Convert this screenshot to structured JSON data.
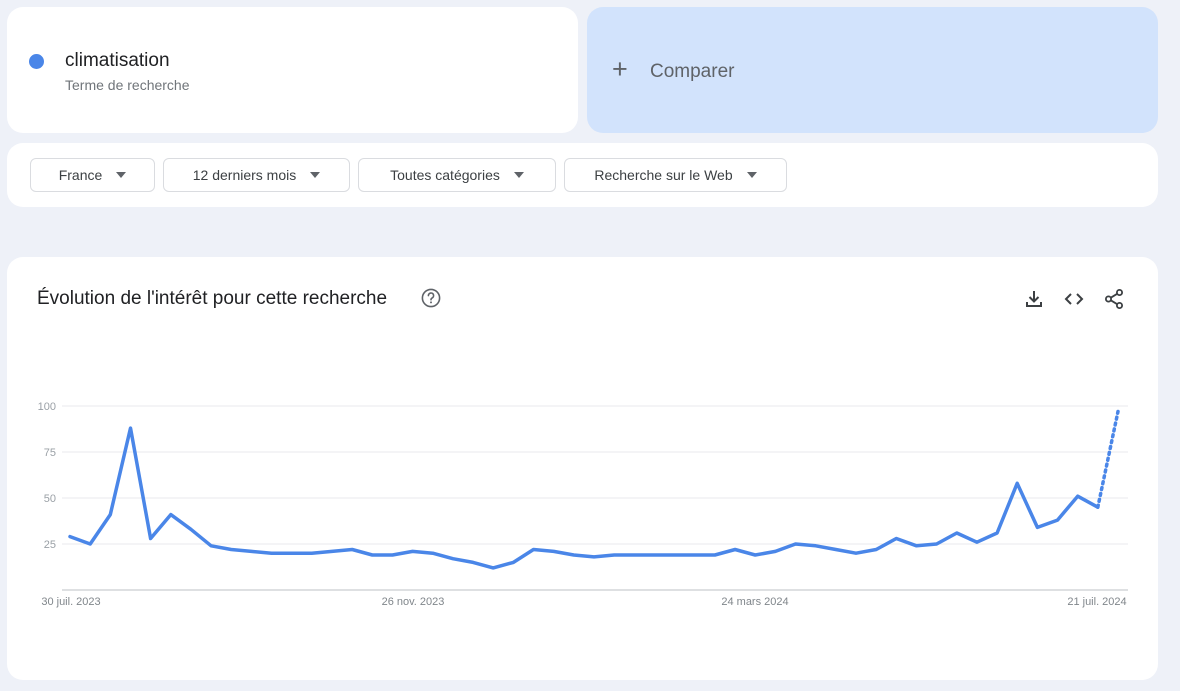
{
  "search_term": {
    "name": "climatisation",
    "subtitle": "Terme de recherche",
    "color": "#4a86e8"
  },
  "compare": {
    "label": "Comparer",
    "icon": "plus-icon"
  },
  "filters": [
    {
      "label": "France"
    },
    {
      "label": "12 derniers mois"
    },
    {
      "label": "Toutes catégories"
    },
    {
      "label": "Recherche sur le Web"
    }
  ],
  "chart_section": {
    "title": "Évolution de l'intérêt pour cette recherche",
    "icons": [
      "help-icon",
      "download-icon",
      "embed-code-icon",
      "share-icon"
    ]
  },
  "chart_data": {
    "type": "line",
    "series": [
      {
        "color": "#4a86e8",
        "values": [
          29,
          25,
          41,
          88,
          28,
          41,
          33,
          24,
          22,
          21,
          20,
          20,
          20,
          21,
          22,
          19,
          19,
          21,
          20,
          17,
          15,
          12,
          15,
          22,
          21,
          19,
          18,
          19,
          19,
          19,
          19,
          19,
          19,
          22,
          19,
          21,
          25,
          24,
          22,
          20,
          22,
          28,
          24,
          25,
          31,
          26,
          31,
          58,
          34,
          38,
          51,
          45,
          97
        ],
        "partial_from_index": 51
      }
    ],
    "y_ticks": [
      "100",
      "75",
      "50",
      "25"
    ],
    "ylim": [
      0,
      100
    ],
    "x_tick_labels": [
      "30 juil. 2023",
      "26 nov. 2023",
      "24 mars 2024",
      "21 juil. 2024"
    ],
    "grid": true
  }
}
